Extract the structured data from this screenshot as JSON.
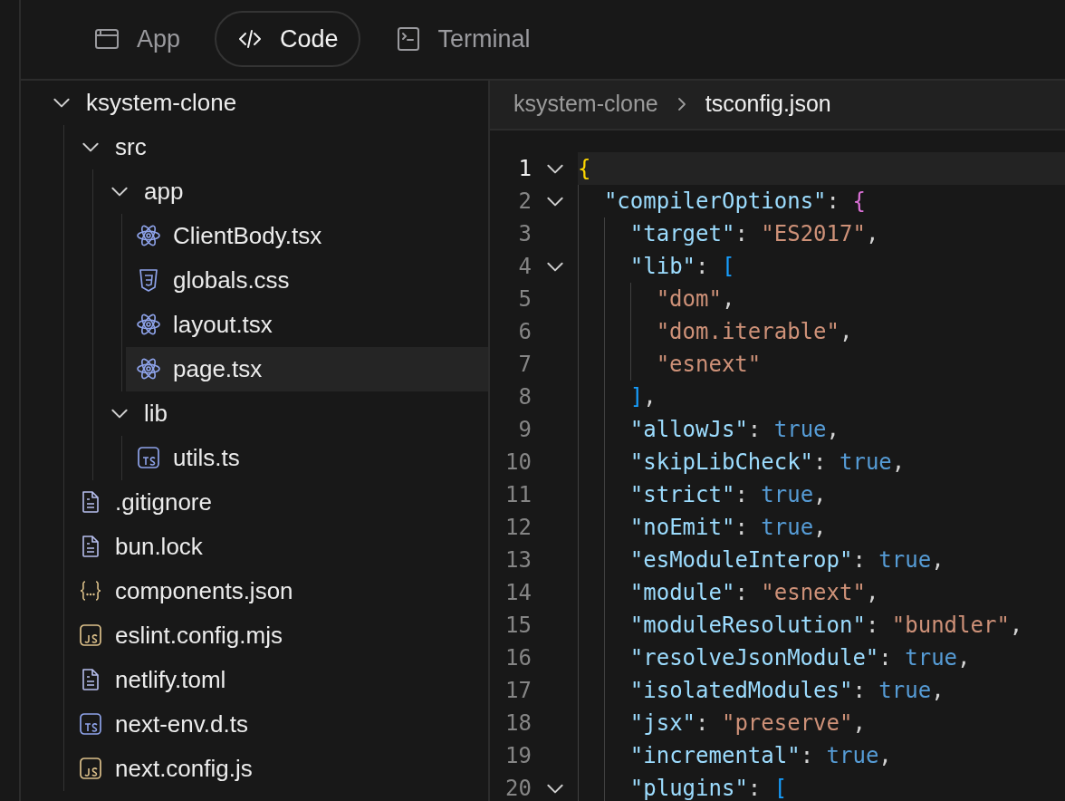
{
  "tabs": [
    {
      "label": "App",
      "kind": "app",
      "selected": false
    },
    {
      "label": "Code",
      "kind": "code",
      "selected": true
    },
    {
      "label": "Terminal",
      "kind": "terminal",
      "selected": false
    }
  ],
  "sidebar": {
    "tree": [
      {
        "label": "ksystem-clone",
        "kind": "folder",
        "expanded": true,
        "selected": false,
        "children": [
          {
            "label": "src",
            "kind": "folder",
            "expanded": true,
            "selected": false,
            "children": [
              {
                "label": "app",
                "kind": "folder",
                "expanded": true,
                "selected": false,
                "children": [
                  {
                    "label": "ClientBody.tsx",
                    "kind": "react",
                    "selected": false
                  },
                  {
                    "label": "globals.css",
                    "kind": "css",
                    "selected": false
                  },
                  {
                    "label": "layout.tsx",
                    "kind": "react",
                    "selected": false
                  },
                  {
                    "label": "page.tsx",
                    "kind": "react",
                    "selected": true
                  }
                ]
              },
              {
                "label": "lib",
                "kind": "folder",
                "expanded": true,
                "selected": false,
                "children": [
                  {
                    "label": "utils.ts",
                    "kind": "ts",
                    "selected": false
                  }
                ]
              }
            ]
          },
          {
            "label": ".gitignore",
            "kind": "text",
            "selected": false
          },
          {
            "label": "bun.lock",
            "kind": "text",
            "selected": false
          },
          {
            "label": "components.json",
            "kind": "json",
            "selected": false
          },
          {
            "label": "eslint.config.mjs",
            "kind": "js",
            "selected": false
          },
          {
            "label": "netlify.toml",
            "kind": "text",
            "selected": false
          },
          {
            "label": "next-env.d.ts",
            "kind": "ts",
            "selected": false
          },
          {
            "label": "next.config.js",
            "kind": "js",
            "selected": false
          }
        ]
      }
    ]
  },
  "editor": {
    "breadcrumb": [
      {
        "label": "ksystem-clone",
        "selected": false
      },
      {
        "label": "tsconfig.json",
        "selected": true
      }
    ],
    "lines": [
      {
        "number": "1",
        "current": true,
        "expanded": true,
        "tokens": [
          {
            "kind": "bracket",
            "text": "{",
            "color": "#ffd700"
          }
        ],
        "children": [
          {
            "number": "2",
            "current": false,
            "expanded": true,
            "tokens": [
              {
                "kind": "key",
                "text": "\"compilerOptions\""
              },
              {
                "kind": "punct",
                "text": ": "
              },
              {
                "kind": "bracket",
                "text": "{",
                "color": "#da70d6"
              }
            ],
            "children": [
              {
                "number": "3",
                "current": false,
                "tokens": [
                  {
                    "kind": "key",
                    "text": "\"target\""
                  },
                  {
                    "kind": "punct",
                    "text": ": "
                  },
                  {
                    "kind": "string",
                    "text": "\"ES2017\""
                  },
                  {
                    "kind": "punct",
                    "text": ","
                  }
                ]
              },
              {
                "number": "4",
                "current": false,
                "expanded": true,
                "tokens": [
                  {
                    "kind": "key",
                    "text": "\"lib\""
                  },
                  {
                    "kind": "punct",
                    "text": ": "
                  },
                  {
                    "kind": "bracket",
                    "text": "[",
                    "color": "#179fff"
                  }
                ],
                "children": [
                  {
                    "number": "5",
                    "current": false,
                    "tokens": [
                      {
                        "kind": "string",
                        "text": "\"dom\""
                      },
                      {
                        "kind": "punct",
                        "text": ","
                      }
                    ]
                  },
                  {
                    "number": "6",
                    "current": false,
                    "tokens": [
                      {
                        "kind": "string",
                        "text": "\"dom.iterable\""
                      },
                      {
                        "kind": "punct",
                        "text": ","
                      }
                    ]
                  },
                  {
                    "number": "7",
                    "current": false,
                    "tokens": [
                      {
                        "kind": "string",
                        "text": "\"esnext\""
                      }
                    ]
                  }
                ]
              },
              {
                "number": "8",
                "current": false,
                "tokens": [
                  {
                    "kind": "bracket",
                    "text": "]",
                    "color": "#179fff"
                  },
                  {
                    "kind": "punct",
                    "text": ","
                  }
                ]
              },
              {
                "number": "9",
                "current": false,
                "tokens": [
                  {
                    "kind": "key",
                    "text": "\"allowJs\""
                  },
                  {
                    "kind": "punct",
                    "text": ": "
                  },
                  {
                    "kind": "bool",
                    "text": "true"
                  },
                  {
                    "kind": "punct",
                    "text": ","
                  }
                ]
              },
              {
                "number": "10",
                "current": false,
                "tokens": [
                  {
                    "kind": "key",
                    "text": "\"skipLibCheck\""
                  },
                  {
                    "kind": "punct",
                    "text": ": "
                  },
                  {
                    "kind": "bool",
                    "text": "true"
                  },
                  {
                    "kind": "punct",
                    "text": ","
                  }
                ]
              },
              {
                "number": "11",
                "current": false,
                "tokens": [
                  {
                    "kind": "key",
                    "text": "\"strict\""
                  },
                  {
                    "kind": "punct",
                    "text": ": "
                  },
                  {
                    "kind": "bool",
                    "text": "true"
                  },
                  {
                    "kind": "punct",
                    "text": ","
                  }
                ]
              },
              {
                "number": "12",
                "current": false,
                "tokens": [
                  {
                    "kind": "key",
                    "text": "\"noEmit\""
                  },
                  {
                    "kind": "punct",
                    "text": ": "
                  },
                  {
                    "kind": "bool",
                    "text": "true"
                  },
                  {
                    "kind": "punct",
                    "text": ","
                  }
                ]
              },
              {
                "number": "13",
                "current": false,
                "tokens": [
                  {
                    "kind": "key",
                    "text": "\"esModuleInterop\""
                  },
                  {
                    "kind": "punct",
                    "text": ": "
                  },
                  {
                    "kind": "bool",
                    "text": "true"
                  },
                  {
                    "kind": "punct",
                    "text": ","
                  }
                ]
              },
              {
                "number": "14",
                "current": false,
                "tokens": [
                  {
                    "kind": "key",
                    "text": "\"module\""
                  },
                  {
                    "kind": "punct",
                    "text": ": "
                  },
                  {
                    "kind": "string",
                    "text": "\"esnext\""
                  },
                  {
                    "kind": "punct",
                    "text": ","
                  }
                ]
              },
              {
                "number": "15",
                "current": false,
                "tokens": [
                  {
                    "kind": "key",
                    "text": "\"moduleResolution\""
                  },
                  {
                    "kind": "punct",
                    "text": ": "
                  },
                  {
                    "kind": "string",
                    "text": "\"bundler\""
                  },
                  {
                    "kind": "punct",
                    "text": ","
                  }
                ]
              },
              {
                "number": "16",
                "current": false,
                "tokens": [
                  {
                    "kind": "key",
                    "text": "\"resolveJsonModule\""
                  },
                  {
                    "kind": "punct",
                    "text": ": "
                  },
                  {
                    "kind": "bool",
                    "text": "true"
                  },
                  {
                    "kind": "punct",
                    "text": ","
                  }
                ]
              },
              {
                "number": "17",
                "current": false,
                "tokens": [
                  {
                    "kind": "key",
                    "text": "\"isolatedModules\""
                  },
                  {
                    "kind": "punct",
                    "text": ": "
                  },
                  {
                    "kind": "bool",
                    "text": "true"
                  },
                  {
                    "kind": "punct",
                    "text": ","
                  }
                ]
              },
              {
                "number": "18",
                "current": false,
                "tokens": [
                  {
                    "kind": "key",
                    "text": "\"jsx\""
                  },
                  {
                    "kind": "punct",
                    "text": ": "
                  },
                  {
                    "kind": "string",
                    "text": "\"preserve\""
                  },
                  {
                    "kind": "punct",
                    "text": ","
                  }
                ]
              },
              {
                "number": "19",
                "current": false,
                "tokens": [
                  {
                    "kind": "key",
                    "text": "\"incremental\""
                  },
                  {
                    "kind": "punct",
                    "text": ": "
                  },
                  {
                    "kind": "bool",
                    "text": "true"
                  },
                  {
                    "kind": "punct",
                    "text": ","
                  }
                ]
              },
              {
                "number": "20",
                "current": false,
                "expanded": true,
                "tokens": [
                  {
                    "kind": "key",
                    "text": "\"plugins\""
                  },
                  {
                    "kind": "punct",
                    "text": ": "
                  },
                  {
                    "kind": "bracket",
                    "text": "[",
                    "color": "#179fff"
                  }
                ]
              }
            ]
          }
        ]
      }
    ]
  }
}
